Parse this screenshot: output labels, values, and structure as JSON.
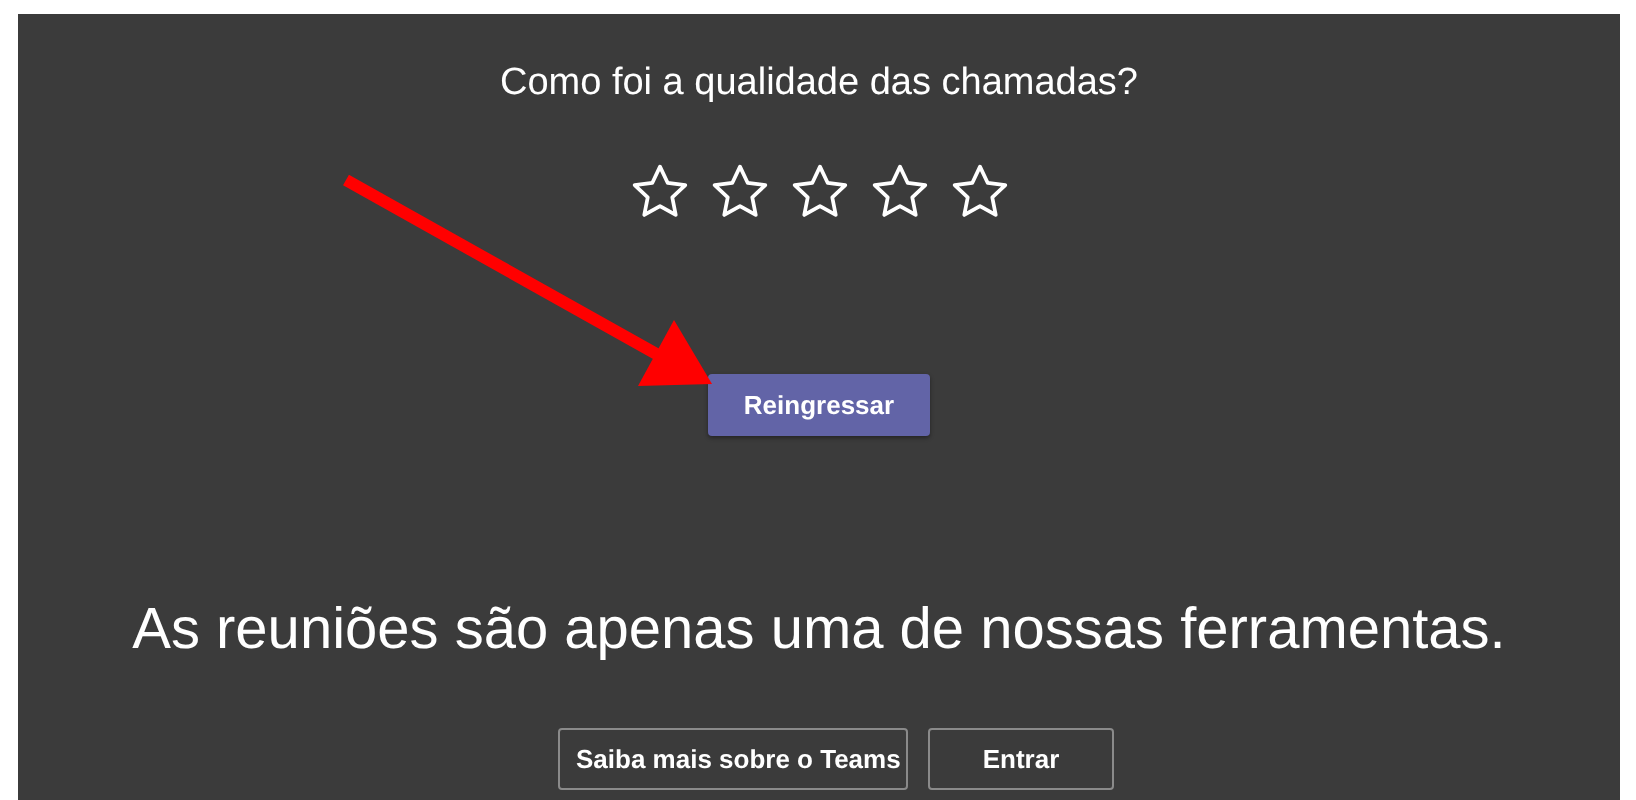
{
  "rating": {
    "question": "Como foi a qualidade das chamadas?",
    "stars": 0
  },
  "rejoin_button": "Reingressar",
  "promo": {
    "headline": "As reuniões são apenas uma de nossas ferramentas.",
    "buttons": [
      "Saiba mais sobre o Teams",
      "Entrar"
    ]
  }
}
